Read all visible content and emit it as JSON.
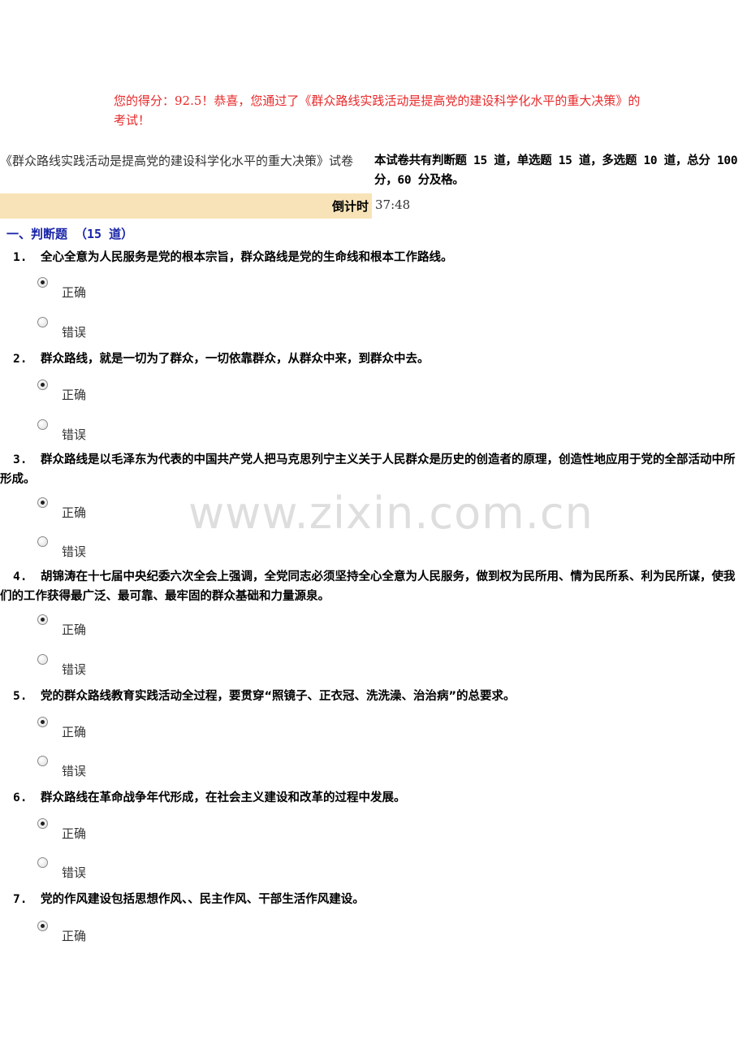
{
  "score_message": "您的得分：92.5！恭喜，您通过了《群众路线实践活动是提高党的建设科学化水平的重大决策》的考试！",
  "exam_title": "《群众路线实践活动是提高党的建设科学化水平的重大决策》试卷",
  "summary": "本试卷共有判断题 15 道，单选题 15 道，多选题 10 道，总分 100 分，60 分及格。",
  "timer": {
    "label": "倒计时",
    "value": "37:48"
  },
  "section_title": "一、判断题 （15 道）",
  "options": {
    "true_label": "正确",
    "false_label": "错误"
  },
  "questions": [
    {
      "num": "1.",
      "text": "全心全意为人民服务是党的根本宗旨，群众路线是党的生命线和根本工作路线。",
      "selected": "true"
    },
    {
      "num": "2.",
      "text": "群众路线，就是一切为了群众，一切依靠群众，从群众中来，到群众中去。",
      "selected": "true"
    },
    {
      "num": "3.",
      "text": "群众路线是以毛泽东为代表的中国共产党人把马克思列宁主义关于人民群众是历史的创造者的原理，创造性地应用于党的全部活动中所形成。",
      "selected": "true"
    },
    {
      "num": "4.",
      "text": "胡锦涛在十七届中央纪委六次全会上强调，全党同志必须坚持全心全意为人民服务，做到权为民所用、情为民所系、利为民所谋，使我们的工作获得最广泛、最可靠、最牢固的群众基础和力量源泉。",
      "selected": "true"
    },
    {
      "num": "5.",
      "text": "党的群众路线教育实践活动全过程，要贯穿“照镜子、正衣冠、洗洗澡、治治病”的总要求。",
      "selected": "true"
    },
    {
      "num": "6.",
      "text": "群众路线在革命战争年代形成，在社会主义建设和改革的过程中发展。",
      "selected": "true"
    },
    {
      "num": "7.",
      "text": "党的作风建设包括思想作风、、民主作风、干部生活作风建设。",
      "selected": "true"
    }
  ],
  "watermark": "www.zixin.com.cn"
}
